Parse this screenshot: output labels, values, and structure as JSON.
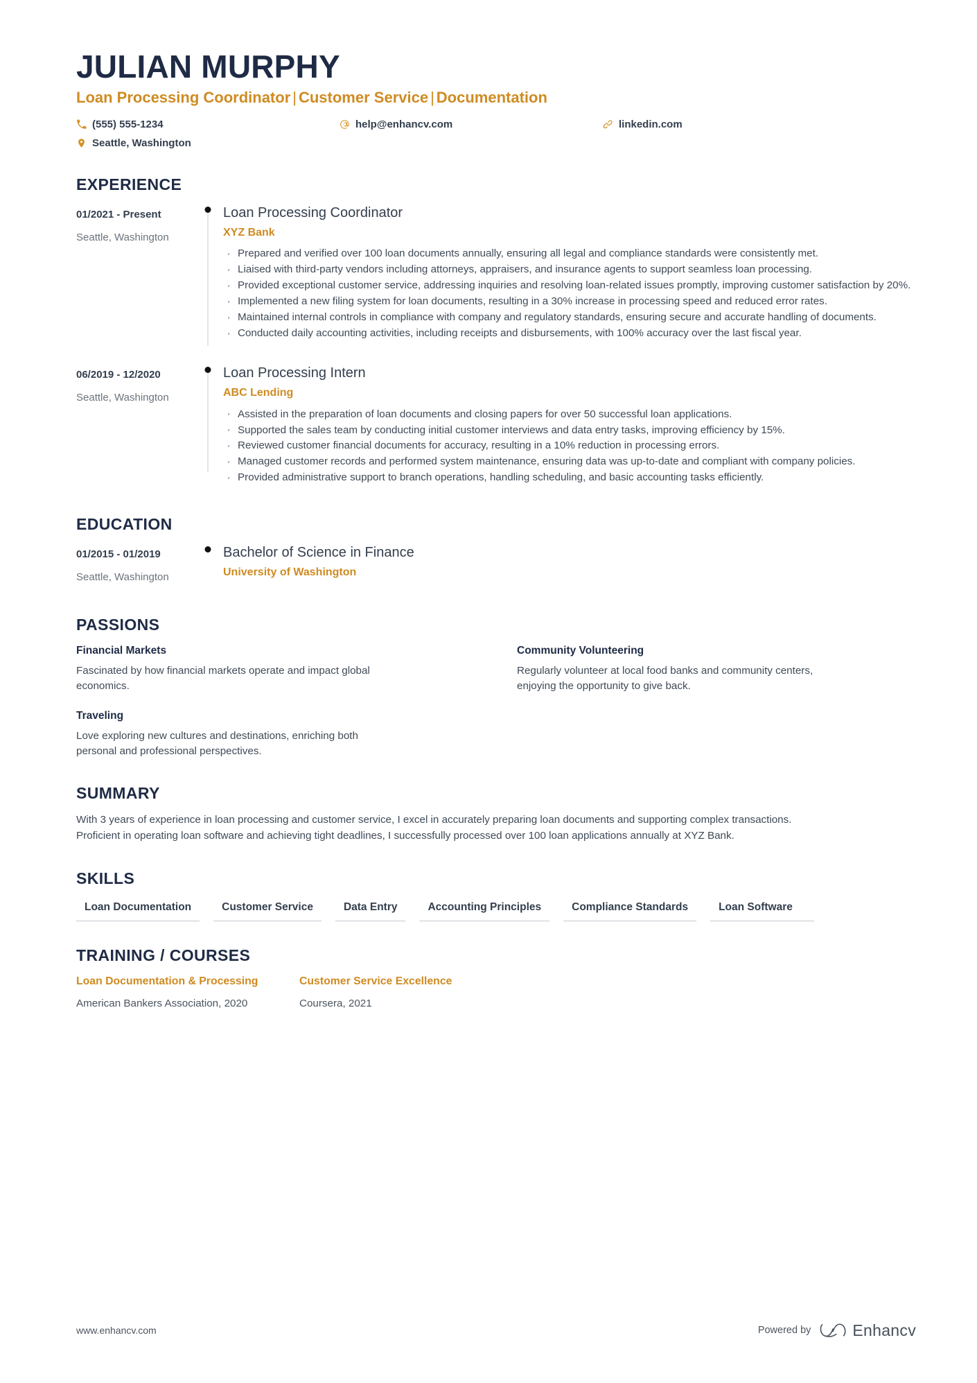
{
  "header": {
    "name": "JULIAN MURPHY",
    "headline_parts": [
      "Loan Processing Coordinator",
      "Customer Service",
      "Documentation"
    ],
    "separator": "|",
    "contacts": [
      {
        "icon": "phone-icon",
        "value": "(555) 555-1234"
      },
      {
        "icon": "email-icon",
        "value": "help@enhancv.com"
      },
      {
        "icon": "link-icon",
        "value": "linkedin.com"
      },
      {
        "icon": "location-pin-icon",
        "value": "Seattle, Washington"
      }
    ]
  },
  "experience": {
    "title": "EXPERIENCE",
    "entries": [
      {
        "date": "01/2021 - Present",
        "location": "Seattle, Washington",
        "role": "Loan Processing Coordinator",
        "company": "XYZ Bank",
        "bullets": [
          "Prepared and verified over 100 loan documents annually, ensuring all legal and compliance standards were consistently met.",
          "Liaised with third-party vendors including attorneys, appraisers, and insurance agents to support seamless loan processing.",
          "Provided exceptional customer service, addressing inquiries and resolving loan-related issues promptly, improving customer satisfaction by 20%.",
          "Implemented a new filing system for loan documents, resulting in a 30% increase in processing speed and reduced error rates.",
          "Maintained internal controls in compliance with company and regulatory standards, ensuring secure and accurate handling of documents.",
          "Conducted daily accounting activities, including receipts and disbursements, with 100% accuracy over the last fiscal year."
        ]
      },
      {
        "date": "06/2019 - 12/2020",
        "location": "Seattle, Washington",
        "role": "Loan Processing Intern",
        "company": "ABC Lending",
        "bullets": [
          "Assisted in the preparation of loan documents and closing papers for over 50 successful loan applications.",
          "Supported the sales team by conducting initial customer interviews and data entry tasks, improving efficiency by 15%.",
          "Reviewed customer financial documents for accuracy, resulting in a 10% reduction in processing errors.",
          "Managed customer records and performed system maintenance, ensuring data was up-to-date and compliant with company policies.",
          "Provided administrative support to branch operations, handling scheduling, and basic accounting tasks efficiently."
        ]
      }
    ]
  },
  "education": {
    "title": "EDUCATION",
    "entries": [
      {
        "date": "01/2015 - 01/2019",
        "location": "Seattle, Washington",
        "degree": "Bachelor of Science in Finance",
        "school": "University of Washington"
      }
    ]
  },
  "passions": {
    "title": "PASSIONS",
    "items": [
      {
        "name": "Financial Markets",
        "text": "Fascinated by how financial markets operate and impact global economics."
      },
      {
        "name": "Community Volunteering",
        "text": "Regularly volunteer at local food banks and community centers, enjoying the opportunity to give back."
      },
      {
        "name": "Traveling",
        "text": "Love exploring new cultures and destinations, enriching both personal and professional perspectives."
      }
    ]
  },
  "summary": {
    "title": "SUMMARY",
    "text": "With 3 years of experience in loan processing and customer service, I excel in accurately preparing loan documents and supporting complex transactions. Proficient in operating loan software and achieving tight deadlines, I successfully processed over 100 loan applications annually at XYZ Bank."
  },
  "skills": {
    "title": "SKILLS",
    "items": [
      "Loan Documentation",
      "Customer Service",
      "Data Entry",
      "Accounting Principles",
      "Compliance Standards",
      "Loan Software"
    ]
  },
  "training": {
    "title": "TRAINING / COURSES",
    "items": [
      {
        "name": "Loan Documentation & Processing",
        "meta": "American Bankers Association, 2020"
      },
      {
        "name": "Customer Service Excellence",
        "meta": "Coursera, 2021"
      }
    ]
  },
  "footer": {
    "url": "www.enhancv.com",
    "powered_by": "Powered by",
    "brand": "Enhancv"
  },
  "colors": {
    "navy": "#1f2b45",
    "amber": "#cf8b22",
    "body_text": "#3f4a57",
    "muted": "#6b737d",
    "rule": "#c6cad0"
  }
}
